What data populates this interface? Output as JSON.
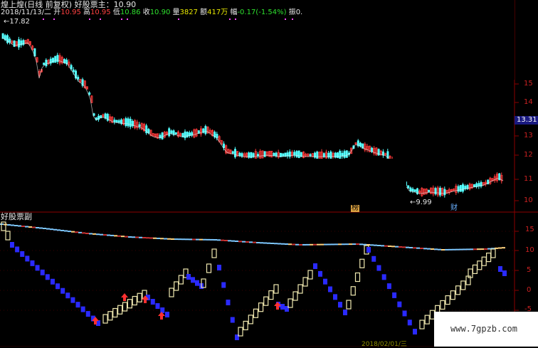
{
  "header": {
    "title": "煌上煌(日线 前复权)",
    "indicator_main": "好股票主：10.90",
    "date": "2018/11/13/二",
    "open_label": "开",
    "open": "10.95",
    "high_label": "高",
    "high": "10.95",
    "low_label": "低",
    "low": "10.86",
    "close_label": "收",
    "close": "10.90",
    "volume_label": "量",
    "volume": "3827",
    "amount_label": "额",
    "amount": "417万",
    "change_label": "幅",
    "change": "-0.17(-1.54%)",
    "amplitude_label": "振",
    "amplitude": "0."
  },
  "main_chart": {
    "high_mark": "17.82",
    "low_mark": "9.99",
    "badge_1": "榜",
    "badge_2": "财",
    "price_axis": [
      "15",
      "14",
      "13",
      "12",
      "11",
      "10"
    ],
    "current_price_tag": "13.31",
    "colors": {
      "up": "#ff3b3b",
      "down": "#54ffff",
      "grid": "#8b0000",
      "axis_text": "#cc2222",
      "tag_bg": "#1a1a80"
    }
  },
  "sub_chart": {
    "title": "好股票副",
    "axis": [
      "15",
      "10",
      "5",
      "0",
      "-5"
    ]
  },
  "watermark": {
    "text": "www.7gpzb.com"
  },
  "footer": {
    "partial_date": "2018/02/01/三"
  }
}
